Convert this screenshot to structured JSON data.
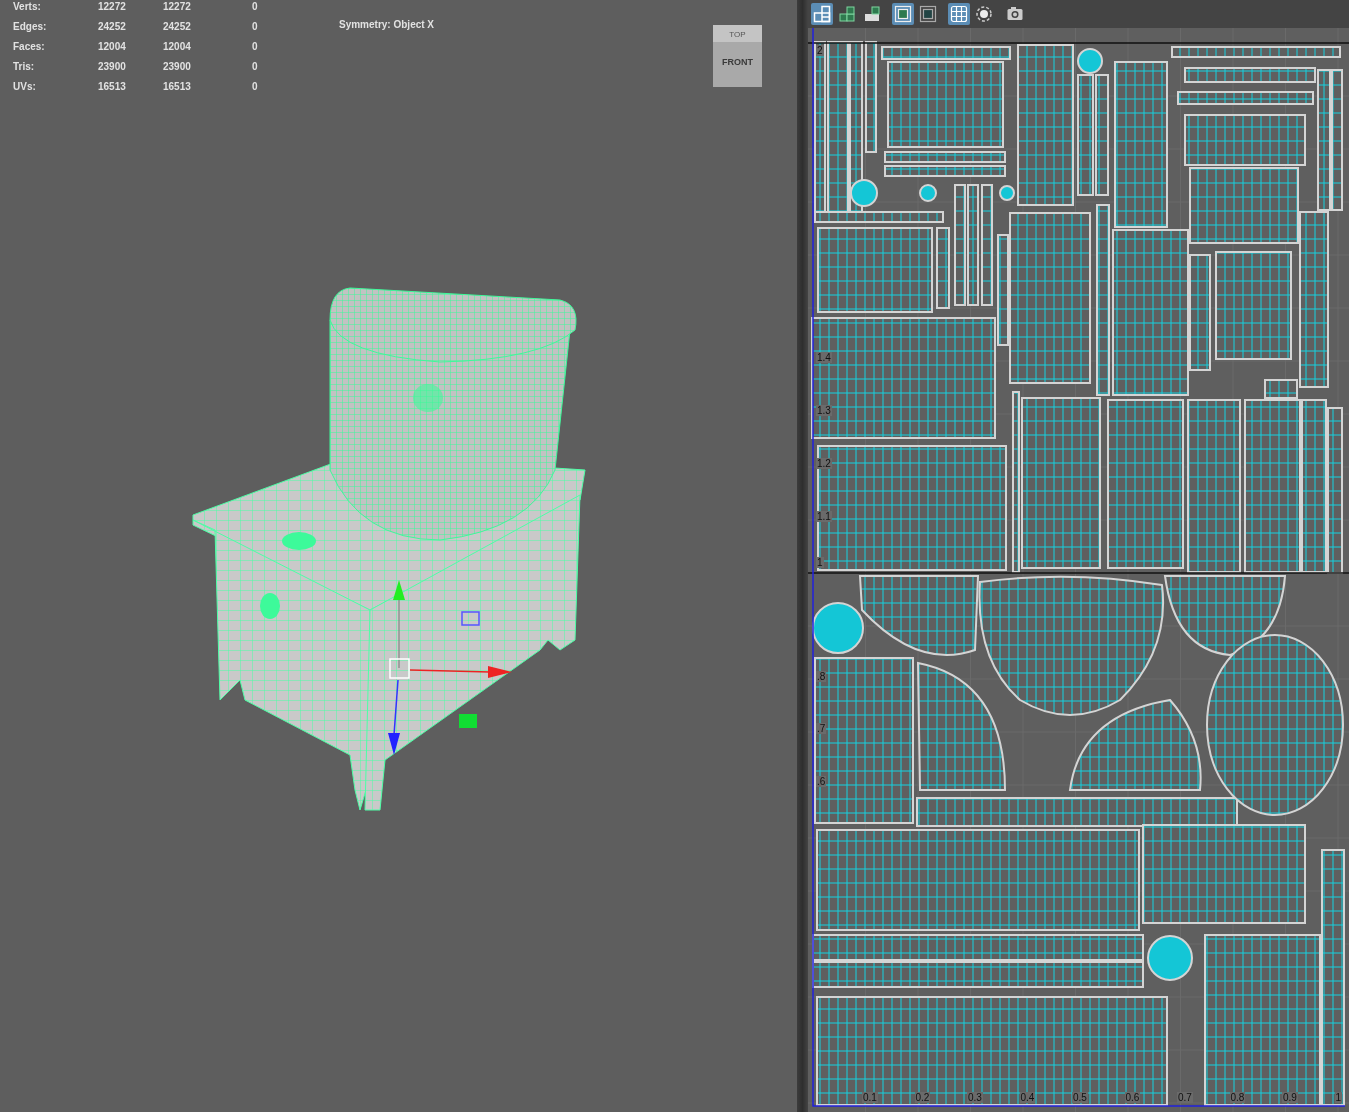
{
  "viewport": {
    "stats": [
      {
        "label": "Verts:",
        "values": [
          "12272",
          "12272",
          "0"
        ]
      },
      {
        "label": "Edges:",
        "values": [
          "24252",
          "24252",
          "0"
        ]
      },
      {
        "label": "Faces:",
        "values": [
          "12004",
          "12004",
          "0"
        ]
      },
      {
        "label": "Tris:",
        "values": [
          "23900",
          "23900",
          "0"
        ]
      },
      {
        "label": "UVs:",
        "values": [
          "16513",
          "16513",
          "0"
        ]
      }
    ],
    "symmetry": "Symmetry: Object X",
    "view_cube": {
      "top": "TOP",
      "front": "FRONT"
    }
  },
  "uv_editor": {
    "toolbar": [
      {
        "kind": "tiles",
        "selected": true
      },
      {
        "kind": "tiles-green",
        "selected": false
      },
      {
        "kind": "tiles-half",
        "selected": false
      },
      {
        "kind": "frame",
        "selected": true
      },
      {
        "kind": "frame-dark",
        "selected": false
      },
      {
        "kind": "grid",
        "selected": true
      },
      {
        "kind": "shaded",
        "selected": false
      },
      {
        "kind": "snapshot",
        "selected": false
      }
    ],
    "v_labels": [
      "2",
      "1.4",
      "1.3",
      "1.2",
      "1.1",
      "1",
      ".8",
      ".7",
      ".6"
    ],
    "u_labels": [
      "0.1",
      "0.2",
      "0.3",
      "0.4",
      "0.5",
      "0.6",
      "0.7",
      "0.8",
      "0.9",
      "1"
    ]
  }
}
